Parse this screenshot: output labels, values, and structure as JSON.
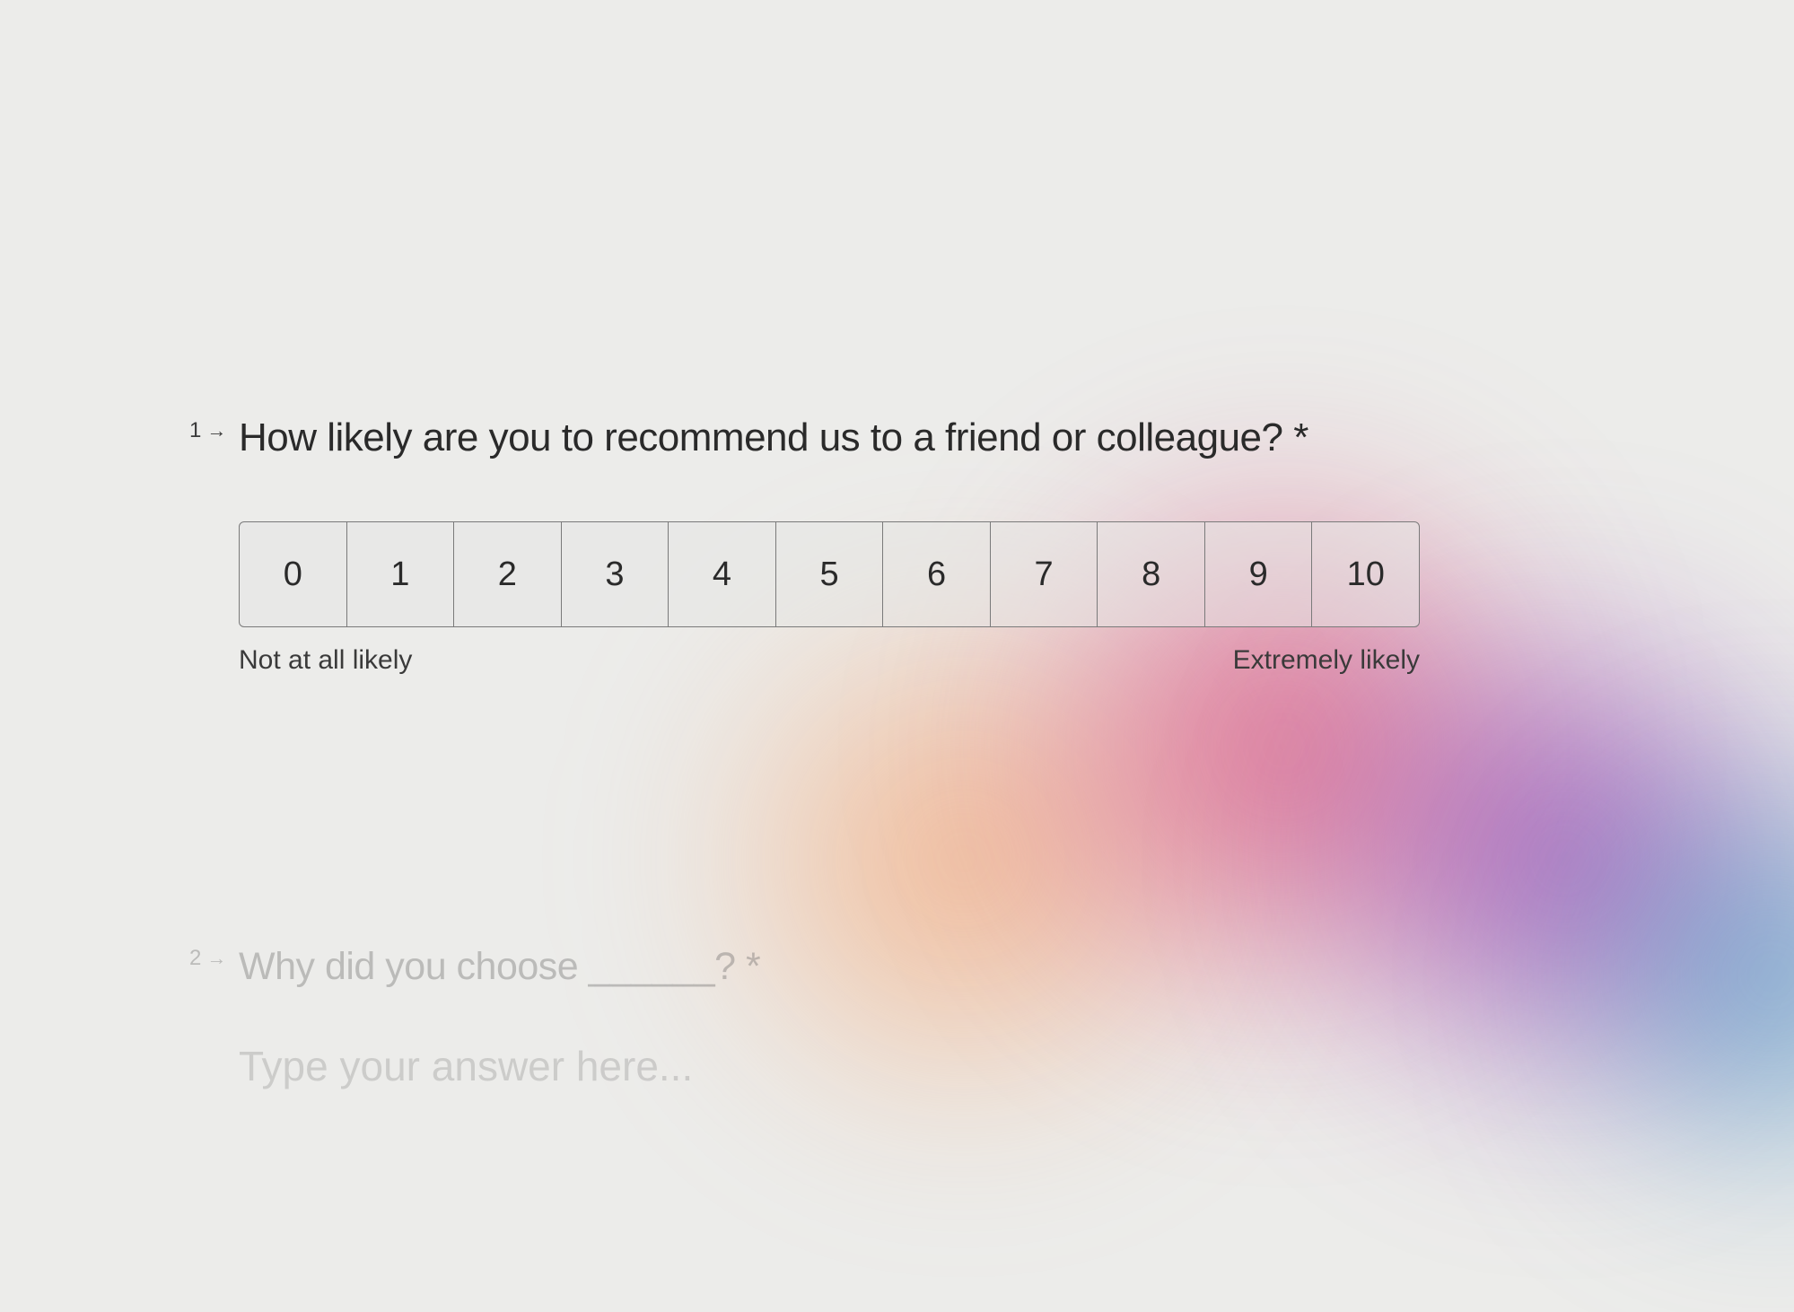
{
  "question1": {
    "number": "1",
    "text": "How likely are you to recommend us to a friend or col­league? *",
    "scale": {
      "options": [
        "0",
        "1",
        "2",
        "3",
        "4",
        "5",
        "6",
        "7",
        "8",
        "9",
        "10"
      ],
      "label_low": "Not at all likely",
      "label_high": "Extremely likely"
    }
  },
  "question2": {
    "number": "2",
    "text": "Why did you choose ______? *",
    "placeholder": "Type your answer here..."
  }
}
